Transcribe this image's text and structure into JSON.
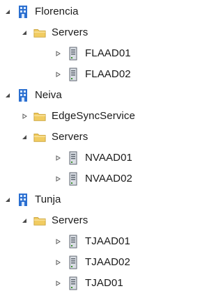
{
  "tree": {
    "sites": [
      {
        "label": "Florencia",
        "containers": [
          {
            "label": "Servers",
            "servers": [
              "FLAAD01",
              "FLAAD02"
            ]
          }
        ]
      },
      {
        "label": "Neiva",
        "containers": [
          {
            "label": "EdgeSyncService"
          },
          {
            "label": "Servers",
            "servers": [
              "NVAAD01",
              "NVAAD02"
            ]
          }
        ]
      },
      {
        "label": "Tunja",
        "containers": [
          {
            "label": "Servers",
            "servers": [
              "TJAAD01",
              "TJAAD02",
              "TJAD01"
            ]
          }
        ]
      }
    ]
  },
  "icons": {
    "expanded": "expanded-arrow-icon",
    "collapsed": "collapsed-arrow-icon",
    "site": "site-icon",
    "folder": "folder-icon",
    "server": "server-icon"
  },
  "colors": {
    "site_blue": "#2b6fd0",
    "folder_yellow": "#f1cc61",
    "arrow_gray": "#5a5a5a"
  }
}
